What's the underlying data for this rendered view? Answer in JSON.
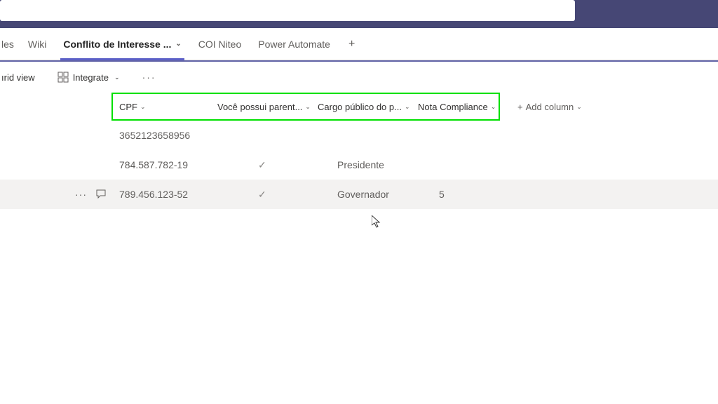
{
  "tabs": {
    "partial_left": "les",
    "wiki": "Wiki",
    "active": "Conflito de Interesse ...",
    "coi": "COI Niteo",
    "power": "Power Automate"
  },
  "toolbar": {
    "grid_view_partial": "ırid view",
    "integrate": "Integrate"
  },
  "columns": {
    "cpf": "CPF",
    "parent": "Você possui parent...",
    "cargo": "Cargo público do p...",
    "nota": "Nota Compliance",
    "add": "Add column"
  },
  "rows": [
    {
      "cpf": "3652123658956",
      "check": false,
      "cargo": "",
      "nota": ""
    },
    {
      "cpf": "784.587.782-19",
      "check": true,
      "cargo": "Presidente",
      "nota": ""
    },
    {
      "cpf": "789.456.123-52",
      "check": true,
      "cargo": "Governador",
      "nota": "5",
      "hover": true
    }
  ]
}
